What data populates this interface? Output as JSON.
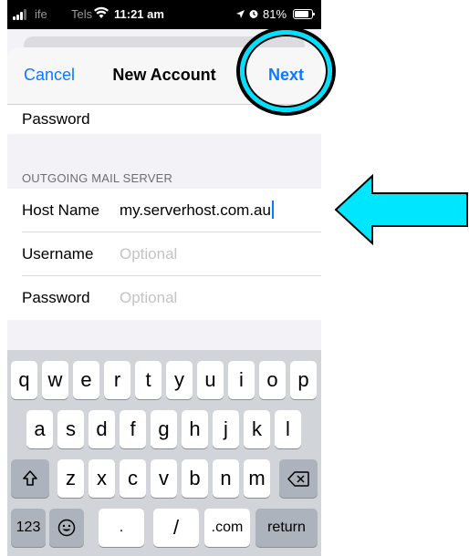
{
  "status_bar": {
    "carrier_left": "ife",
    "carrier": "Tels",
    "time": "11:21 am",
    "battery": "81%"
  },
  "nav": {
    "cancel_label": "Cancel",
    "title": "New Account",
    "next_label": "Next"
  },
  "form": {
    "incoming_password_label": "Password",
    "outgoing_header": "OUTGOING MAIL SERVER",
    "host_name_label": "Host Name",
    "host_name_value": "my.serverhost.com.au",
    "username_label": "Username",
    "username_placeholder": "Optional",
    "password_label": "Password",
    "password_placeholder": "Optional"
  },
  "keyboard": {
    "row1": [
      "q",
      "w",
      "e",
      "r",
      "t",
      "y",
      "u",
      "i",
      "o",
      "p"
    ],
    "row2": [
      "a",
      "s",
      "d",
      "f",
      "g",
      "h",
      "j",
      "k",
      "l"
    ],
    "row3": [
      "z",
      "x",
      "c",
      "v",
      "b",
      "n",
      "m"
    ],
    "bottom": {
      "numbers": "123",
      "dot": ".",
      "slash": "/",
      "dotcom": ".com",
      "return": "return"
    }
  },
  "colors": {
    "accent": "#0a7aff",
    "annotation": "#00e0ff"
  },
  "icons": {
    "shift": "shift-icon",
    "delete": "delete-icon",
    "emoji": "emoji-icon",
    "arrow": "left-arrow-icon",
    "wifi": "wifi-icon",
    "location": "location-icon",
    "alarm": "alarm-icon"
  }
}
